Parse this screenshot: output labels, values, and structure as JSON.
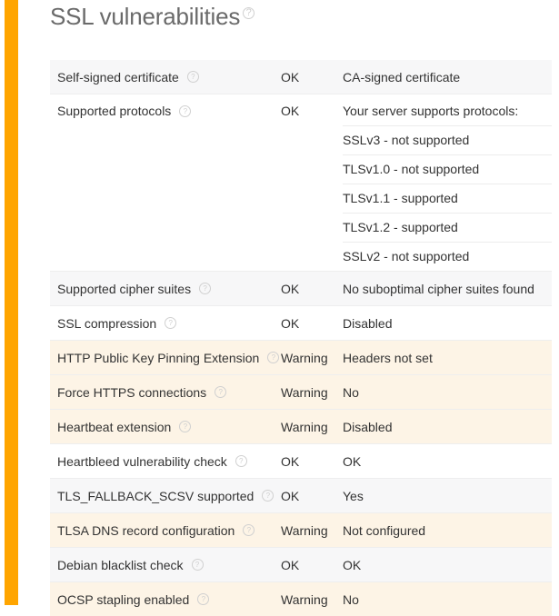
{
  "section": {
    "title": "SSL vulnerabilities",
    "accent_color": "#ffa500"
  },
  "rows": [
    {
      "name": "Self-signed certificate",
      "status": "OK",
      "value": "CA-signed certificate"
    },
    {
      "name": "Supported protocols",
      "status": "OK",
      "value": "Your server supports protocols:",
      "sub_values": [
        "SSLv3 - not supported",
        "TLSv1.0 - not supported",
        "TLSv1.1 - supported",
        "TLSv1.2 - supported",
        "SSLv2 - not supported"
      ]
    },
    {
      "name": "Supported cipher suites",
      "status": "OK",
      "value": "No suboptimal cipher suites found"
    },
    {
      "name": "SSL compression",
      "status": "OK",
      "value": "Disabled"
    },
    {
      "name": "HTTP Public Key Pinning Extension",
      "status": "Warning",
      "value": "Headers not set"
    },
    {
      "name": "Force HTTPS connections",
      "status": "Warning",
      "value": "No"
    },
    {
      "name": "Heartbeat extension",
      "status": "Warning",
      "value": "Disabled"
    },
    {
      "name": "Heartbleed vulnerability check",
      "status": "OK",
      "value": "OK"
    },
    {
      "name": "TLS_FALLBACK_SCSV supported",
      "status": "OK",
      "value": "Yes"
    },
    {
      "name": "TLSA DNS record configuration",
      "status": "Warning",
      "value": "Not configured"
    },
    {
      "name": "Debian blacklist check",
      "status": "OK",
      "value": "OK"
    },
    {
      "name": "OCSP stapling enabled",
      "status": "Warning",
      "value": "No"
    }
  ],
  "help_icon": "question-circle-icon",
  "colors": {
    "warning_row": "#fdf4e6",
    "alt_row": "#f7f7f8"
  }
}
